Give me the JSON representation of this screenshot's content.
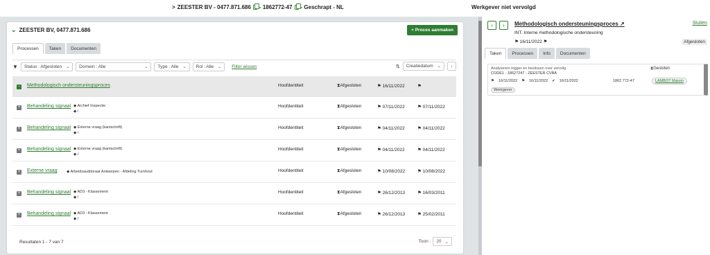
{
  "topbar": {
    "prefix": ">",
    "company": "ZEESTER BV - 0477.871.686",
    "case": "- 1862772-47",
    "status": "- Geschrapt - NL",
    "right_status": "Werkgever niet vervolgd"
  },
  "panel": {
    "title": "ZEESTER BV, 0477.871.686",
    "add_process_label": "+ Proces aanmaken",
    "tabs": [
      "Processen",
      "Taken",
      "Documenten"
    ],
    "filters": {
      "status": "Status : Afgesloten",
      "domein": "Domein : Alle",
      "type": "Type : Alle",
      "rol": "Rol : Alle",
      "clear": "Filter wissen",
      "sort": "Creatiedatum"
    },
    "rows": [
      {
        "name": "Methodologisch ondersteuningsproces",
        "tag1": "",
        "tag2": "",
        "entity": "Hoofdentiteit",
        "status": "Afgesloten",
        "d1": "16/11/2022",
        "d2": "",
        "selected": true
      },
      {
        "name": "Behandeling signaal",
        "tag1": "Archief Inspectie",
        "tag2": "/",
        "entity": "Hoofdentiteit",
        "status": "Afgesloten",
        "d1": "07/11/2022",
        "d2": "07/11/2022"
      },
      {
        "name": "Behandeling signaal",
        "tag1": "Externe vraag (kantschrift)",
        "tag2": "/",
        "entity": "Hoofdentiteit",
        "status": "Afgesloten",
        "d1": "04/11/2022",
        "d2": "04/11/2022"
      },
      {
        "name": "Behandeling signaal",
        "tag1": "Externe vraag (kantschrift)",
        "tag2": "/",
        "entity": "Hoofdentiteit",
        "status": "Afgesloten",
        "d1": "04/11/2022",
        "d2": "04/11/2022"
      },
      {
        "name": "Externe vraag",
        "tag1": "Arbeidsauditoraat Antwerpen - Afdeling Turnhout",
        "tag2": "",
        "entity": "Hoofdentiteit",
        "status": "Afgesloten",
        "d1": "10/08/2022",
        "d2": "10/08/2022"
      },
      {
        "name": "Behandeling signaal",
        "tag1": "AD3 - Klassement",
        "tag2": "/",
        "entity": "Hoofdentiteit",
        "status": "Afgesloten",
        "d1": "26/12/2013",
        "d2": "16/03/2011"
      },
      {
        "name": "Behandeling signaal",
        "tag1": "AD3 - Klassement",
        "tag2": "/",
        "entity": "Hoofdentiteit",
        "status": "Afgesloten",
        "d1": "26/12/2013",
        "d2": "25/02/2011"
      }
    ],
    "results": "Resultaten 1 - 7 van 7",
    "show_label": "Toon :",
    "show_value": "20"
  },
  "detail": {
    "title": "Methodologisch ondersteuningsproces",
    "close": "Sluiten",
    "subtitle": "INT. Interne methodologische ondersteuning",
    "date": "16/11/2022",
    "badge": "Afgesloten",
    "tabs": [
      "Taken",
      "Processen",
      "Info",
      "Documenten"
    ],
    "card": {
      "line1": "Analyseren trigger en beslissen over vervolg",
      "line2": "CODE1 - 18627247 - ZEESTER CVBA",
      "d1": "16/11/2022",
      "d2": "16/11/2022",
      "d3": "16/11/2022",
      "status": "Gesloten",
      "number": "1862 772-47",
      "user": "LAMBOT Manon",
      "tag": "Werkgever"
    }
  }
}
